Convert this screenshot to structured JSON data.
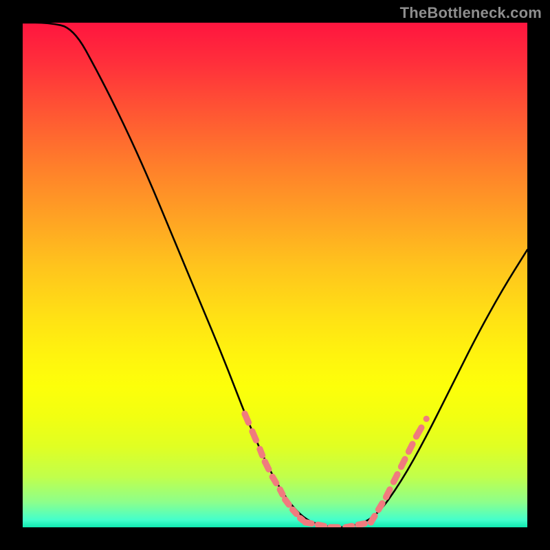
{
  "watermark": "TheBottleneck.com",
  "colors": {
    "background": "#000000",
    "gradient_top": "#ff153f",
    "gradient_mid": "#fff40e",
    "gradient_bottom": "#10e9b0",
    "curve": "#000000",
    "dots": "#f07b7e"
  },
  "chart_data": {
    "type": "line",
    "title": "",
    "xlabel": "",
    "ylabel": "",
    "xlim": [
      0,
      1
    ],
    "ylim": [
      0,
      1
    ],
    "x": [
      0.0,
      0.05,
      0.1,
      0.15,
      0.2,
      0.25,
      0.3,
      0.35,
      0.4,
      0.45,
      0.5,
      0.55,
      0.6,
      0.65,
      0.7,
      0.75,
      0.8,
      0.85,
      0.9,
      0.95,
      1.0
    ],
    "values": [
      1.0,
      1.0,
      0.99,
      0.9,
      0.8,
      0.69,
      0.57,
      0.45,
      0.33,
      0.2,
      0.09,
      0.02,
      0.0,
      0.0,
      0.02,
      0.09,
      0.18,
      0.28,
      0.38,
      0.47,
      0.55
    ],
    "series": [
      {
        "name": "dots-left",
        "x": [
          0.44,
          0.455,
          0.47,
          0.48,
          0.495,
          0.51,
          0.52,
          0.535,
          0.55,
          0.56
        ],
        "values": [
          0.225,
          0.19,
          0.155,
          0.13,
          0.1,
          0.075,
          0.055,
          0.035,
          0.018,
          0.01
        ]
      },
      {
        "name": "dots-bottom",
        "x": [
          0.56,
          0.585,
          0.61,
          0.64,
          0.665,
          0.69
        ],
        "values": [
          0.01,
          0.005,
          0.0,
          0.0,
          0.005,
          0.01
        ]
      },
      {
        "name": "dots-right",
        "x": [
          0.69,
          0.705,
          0.72,
          0.735,
          0.75,
          0.765,
          0.78,
          0.8
        ],
        "values": [
          0.01,
          0.035,
          0.06,
          0.09,
          0.12,
          0.15,
          0.18,
          0.215
        ]
      }
    ]
  }
}
